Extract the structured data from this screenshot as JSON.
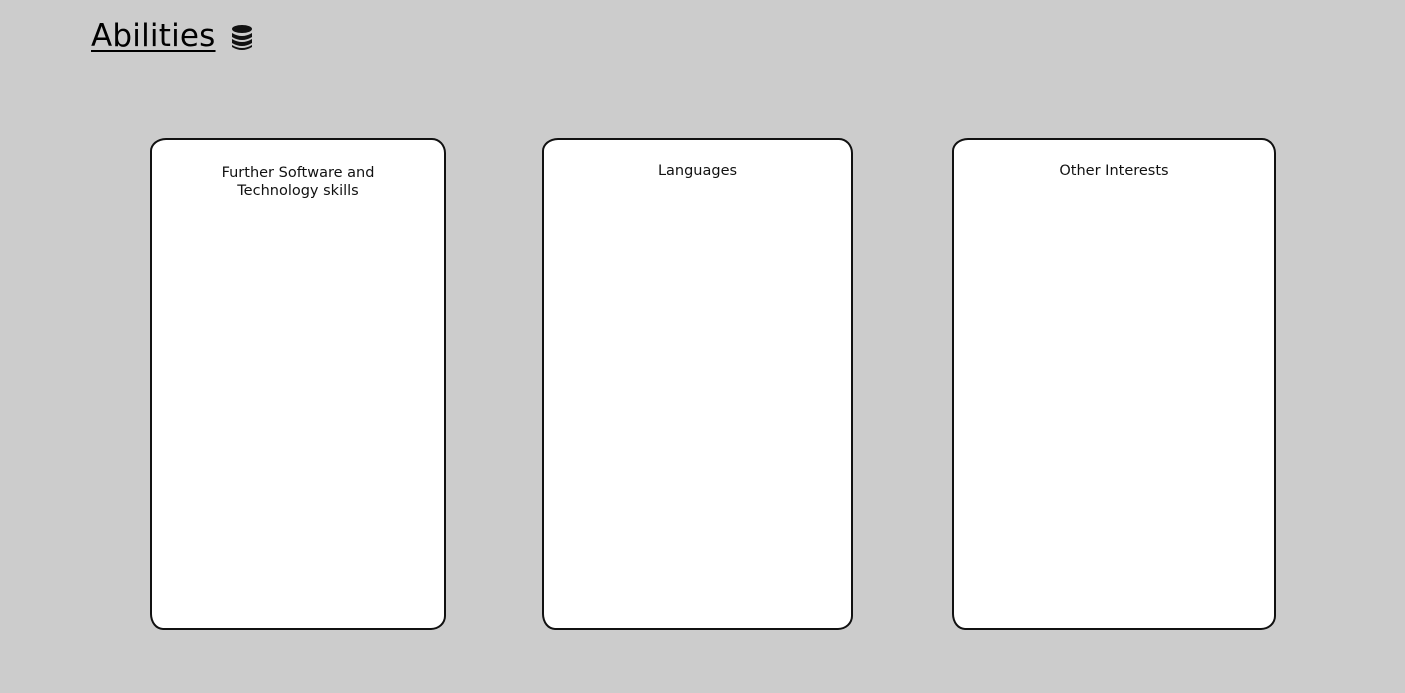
{
  "header": {
    "title": "Abilities",
    "icon": "database-icon"
  },
  "cards": [
    {
      "title": "Further Software and Technology skills"
    },
    {
      "title": "Languages"
    },
    {
      "title": "Other Interests"
    }
  ],
  "colors": {
    "background": "#cccccc",
    "card": "#ffffff",
    "border": "#111111"
  }
}
